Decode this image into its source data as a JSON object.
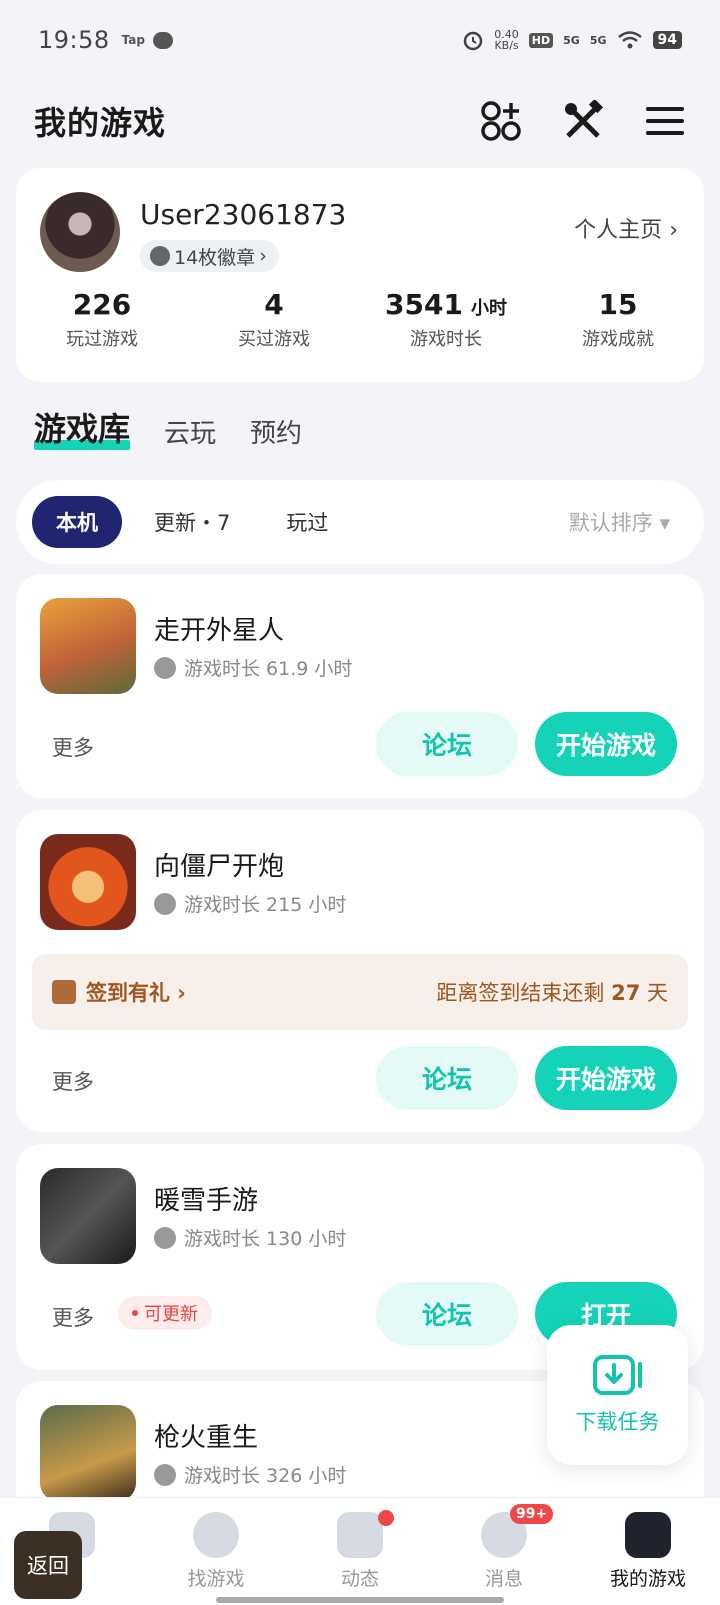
{
  "status_bar": {
    "time": "19:58",
    "app_tag": "Tap",
    "net_speed_value": "0.40",
    "net_speed_unit": "KB/s",
    "hd": "HD",
    "sig1": "5G",
    "sig2": "5G",
    "battery": "94"
  },
  "header": {
    "title": "我的游戏",
    "icons": [
      "apps-grid-icon",
      "tools-icon",
      "menu-icon"
    ]
  },
  "profile": {
    "username": "User23061873",
    "badges": "14枚徽章",
    "homepage_link": "个人主页",
    "stats": [
      {
        "value": "226",
        "unit": "",
        "label": "玩过游戏"
      },
      {
        "value": "4",
        "unit": "",
        "label": "买过游戏"
      },
      {
        "value": "3541",
        "unit": "小时",
        "label": "游戏时长"
      },
      {
        "value": "15",
        "unit": "",
        "label": "游戏成就"
      }
    ]
  },
  "library_tabs": [
    "游戏库",
    "云玩",
    "预约"
  ],
  "filters": {
    "chips": [
      "本机",
      "更新・7",
      "玩过"
    ],
    "sort": "默认排序"
  },
  "games": [
    {
      "name": "走开外星人",
      "playtime": "游戏时长 61.9 小时",
      "more": "更多",
      "forum": "论坛",
      "action": "开始游戏"
    },
    {
      "name": "向僵尸开炮",
      "playtime": "游戏时长 215 小时",
      "signin_label": "签到有礼",
      "signin_prefix": "距离签到结束还剩 ",
      "signin_days": "27",
      "signin_suffix": " 天",
      "more": "更多",
      "forum": "论坛",
      "action": "开始游戏"
    },
    {
      "name": "暖雪手游",
      "playtime": "游戏时长 130 小时",
      "more": "更多",
      "update_tag": "可更新",
      "forum": "论坛",
      "action": "打开"
    },
    {
      "name": "枪火重生",
      "playtime": "游戏时长 326 小时"
    }
  ],
  "download_float": {
    "label": "下载任务"
  },
  "bottom_nav": [
    {
      "label": "",
      "icon": "home-icon"
    },
    {
      "label": "找游戏",
      "icon": "planet-icon"
    },
    {
      "label": "动态",
      "icon": "feed-icon"
    },
    {
      "label": "消息",
      "icon": "message-icon",
      "badge": "99+"
    },
    {
      "label": "我的游戏",
      "icon": "gamepad-icon"
    }
  ],
  "back_button": "返回",
  "colors": {
    "accent": "#15d3b8",
    "nav_active": "#1f2570",
    "signin_text": "#a0561f"
  }
}
